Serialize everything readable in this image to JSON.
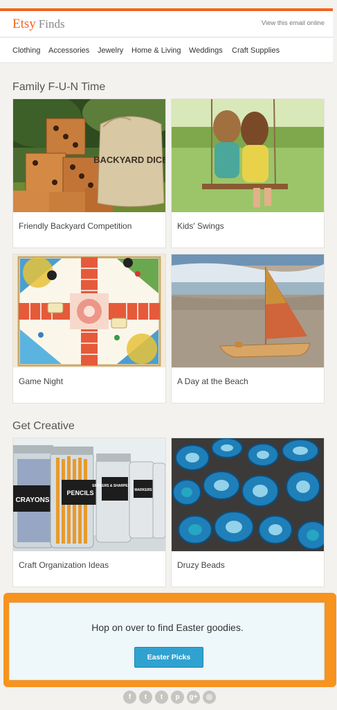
{
  "header": {
    "brand": "Etsy",
    "brand_suffix": "Finds",
    "view_online": "View this email online"
  },
  "nav": {
    "items": [
      "Clothing",
      "Accessories",
      "Jewelry",
      "Home & Living",
      "Weddings",
      "Craft Supplies"
    ]
  },
  "sections": [
    {
      "title": "Family F-U-N Time",
      "cards": [
        {
          "caption": "Friendly Backyard Competition",
          "image": "backyard-dice-photo",
          "label": "BACKYARD DICE"
        },
        {
          "caption": "Kids' Swings",
          "image": "kids-swings-photo"
        },
        {
          "caption": "Game Night",
          "image": "game-board-photo"
        },
        {
          "caption": "A Day at the Beach",
          "image": "toy-sailboat-photo"
        }
      ]
    },
    {
      "title": "Get Creative",
      "cards": [
        {
          "caption": "Craft Organization Ideas",
          "image": "craft-jars-photo",
          "jar_labels": [
            "CRAYONS",
            "PENCILS",
            "ERASERS & SHARPENERS",
            "MARKERS"
          ]
        },
        {
          "caption": "Druzy Beads",
          "image": "druzy-beads-photo"
        }
      ]
    }
  ],
  "cta": {
    "text": "Hop on over to find Easter goodies.",
    "button": "Easter Picks"
  },
  "social": [
    {
      "icon": "facebook-icon",
      "glyph": "f"
    },
    {
      "icon": "twitter-icon",
      "glyph": "t"
    },
    {
      "icon": "tumblr-icon",
      "glyph": "t"
    },
    {
      "icon": "pinterest-icon",
      "glyph": "p"
    },
    {
      "icon": "googleplus-icon",
      "glyph": "g+"
    },
    {
      "icon": "instagram-icon",
      "glyph": "◎"
    }
  ],
  "colors": {
    "accent": "#f1641e",
    "cta_border": "#f7931e",
    "cta_button": "#30a2cf"
  }
}
